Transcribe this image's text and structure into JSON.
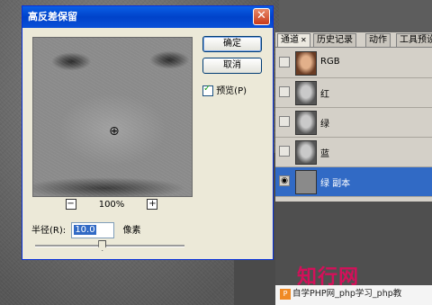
{
  "dialog": {
    "title": "高反差保留",
    "close_glyph": "✕",
    "ok_label": "确定",
    "cancel_label": "取消",
    "preview_label": "预览(P)",
    "preview_checked": true,
    "zoom_minus": "−",
    "zoom_plus": "+",
    "zoom_value": "100%",
    "radius_label": "半径(R):",
    "radius_value": "10.0",
    "radius_unit": "像素",
    "radius_slider_level": 0.45
  },
  "panel": {
    "tabs": [
      {
        "label": "通道",
        "close": "✕"
      },
      {
        "label": "历史记录"
      },
      {
        "label": "动作"
      },
      {
        "label": "工具预设"
      }
    ],
    "channels": [
      {
        "name": "RGB",
        "thumb": "color"
      },
      {
        "name": "红",
        "thumb": "gray-face"
      },
      {
        "name": "绿",
        "thumb": "gray-face"
      },
      {
        "name": "蓝",
        "thumb": "gray-face"
      },
      {
        "name": "绿 副本",
        "thumb": "gray",
        "selected": true,
        "visible": true
      }
    ],
    "eye_glyph": "◉"
  },
  "watermark": "知行网",
  "footer": {
    "logo": "P",
    "text": "自学PHP网_php学习_php教"
  },
  "colors": {
    "title_blue": "#0a5fe6",
    "selection_blue": "#316ac5",
    "watermark_red": "#d4105a"
  },
  "icons": [
    "close-icon",
    "zoom-in-cursor-icon",
    "checkbox-check-icon",
    "eye-icon",
    "tab-close-icon"
  ]
}
